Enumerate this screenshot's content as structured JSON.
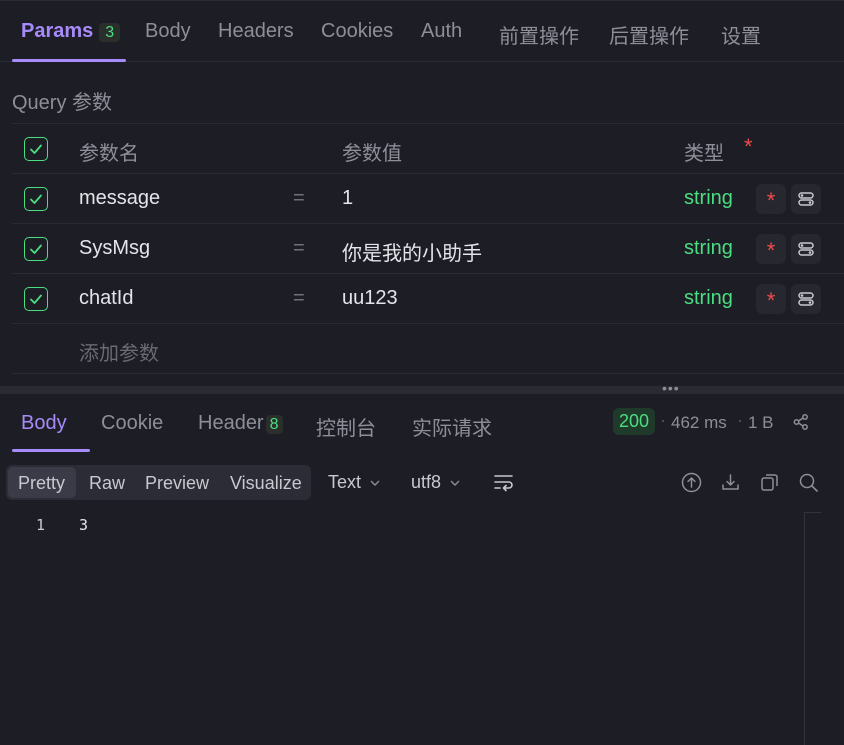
{
  "request_tabs": [
    {
      "label": "Params",
      "count": "3"
    },
    {
      "label": "Body"
    },
    {
      "label": "Headers"
    },
    {
      "label": "Cookies"
    },
    {
      "label": "Auth"
    },
    {
      "label": "前置操作"
    },
    {
      "label": "后置操作"
    },
    {
      "label": "设置"
    }
  ],
  "query_section_title": "Query 参数",
  "table_header": {
    "name": "参数名",
    "value": "参数值",
    "type": "类型",
    "required_mark": "*"
  },
  "params": [
    {
      "name": "message",
      "eq": "=",
      "value": "1",
      "type": "string",
      "required": "*"
    },
    {
      "name": "SysMsg",
      "eq": "=",
      "value": "你是我的小助手",
      "type": "string",
      "required": "*"
    },
    {
      "name": "chatId",
      "eq": "=",
      "value": "uu123",
      "type": "string",
      "required": "*"
    }
  ],
  "add_param_placeholder": "添加参数",
  "splitter_handle": "•••",
  "response_tabs": [
    {
      "label": "Body"
    },
    {
      "label": "Cookie"
    },
    {
      "label": "Header",
      "count": "8"
    },
    {
      "label": "控制台"
    },
    {
      "label": "实际请求"
    }
  ],
  "status_code": "200",
  "response_time": "462 ms",
  "response_size": "1 B",
  "format_buttons": [
    "Pretty",
    "Raw",
    "Preview",
    "Visualize"
  ],
  "content_type_select": "Text",
  "encoding_select": "utf8",
  "code_lines": [
    {
      "line": "1",
      "text": "3"
    }
  ],
  "colors": {
    "accent": "#a78bfa",
    "success": "#4ade80",
    "required": "#f04b4b",
    "background": "#1d1d25"
  },
  "icons": [
    "check-icon",
    "toggle-options-icon",
    "share-icon",
    "wrap-lines-icon",
    "upload-icon",
    "download-icon",
    "copy-icon",
    "search-icon",
    "chevron-down-icon"
  ]
}
